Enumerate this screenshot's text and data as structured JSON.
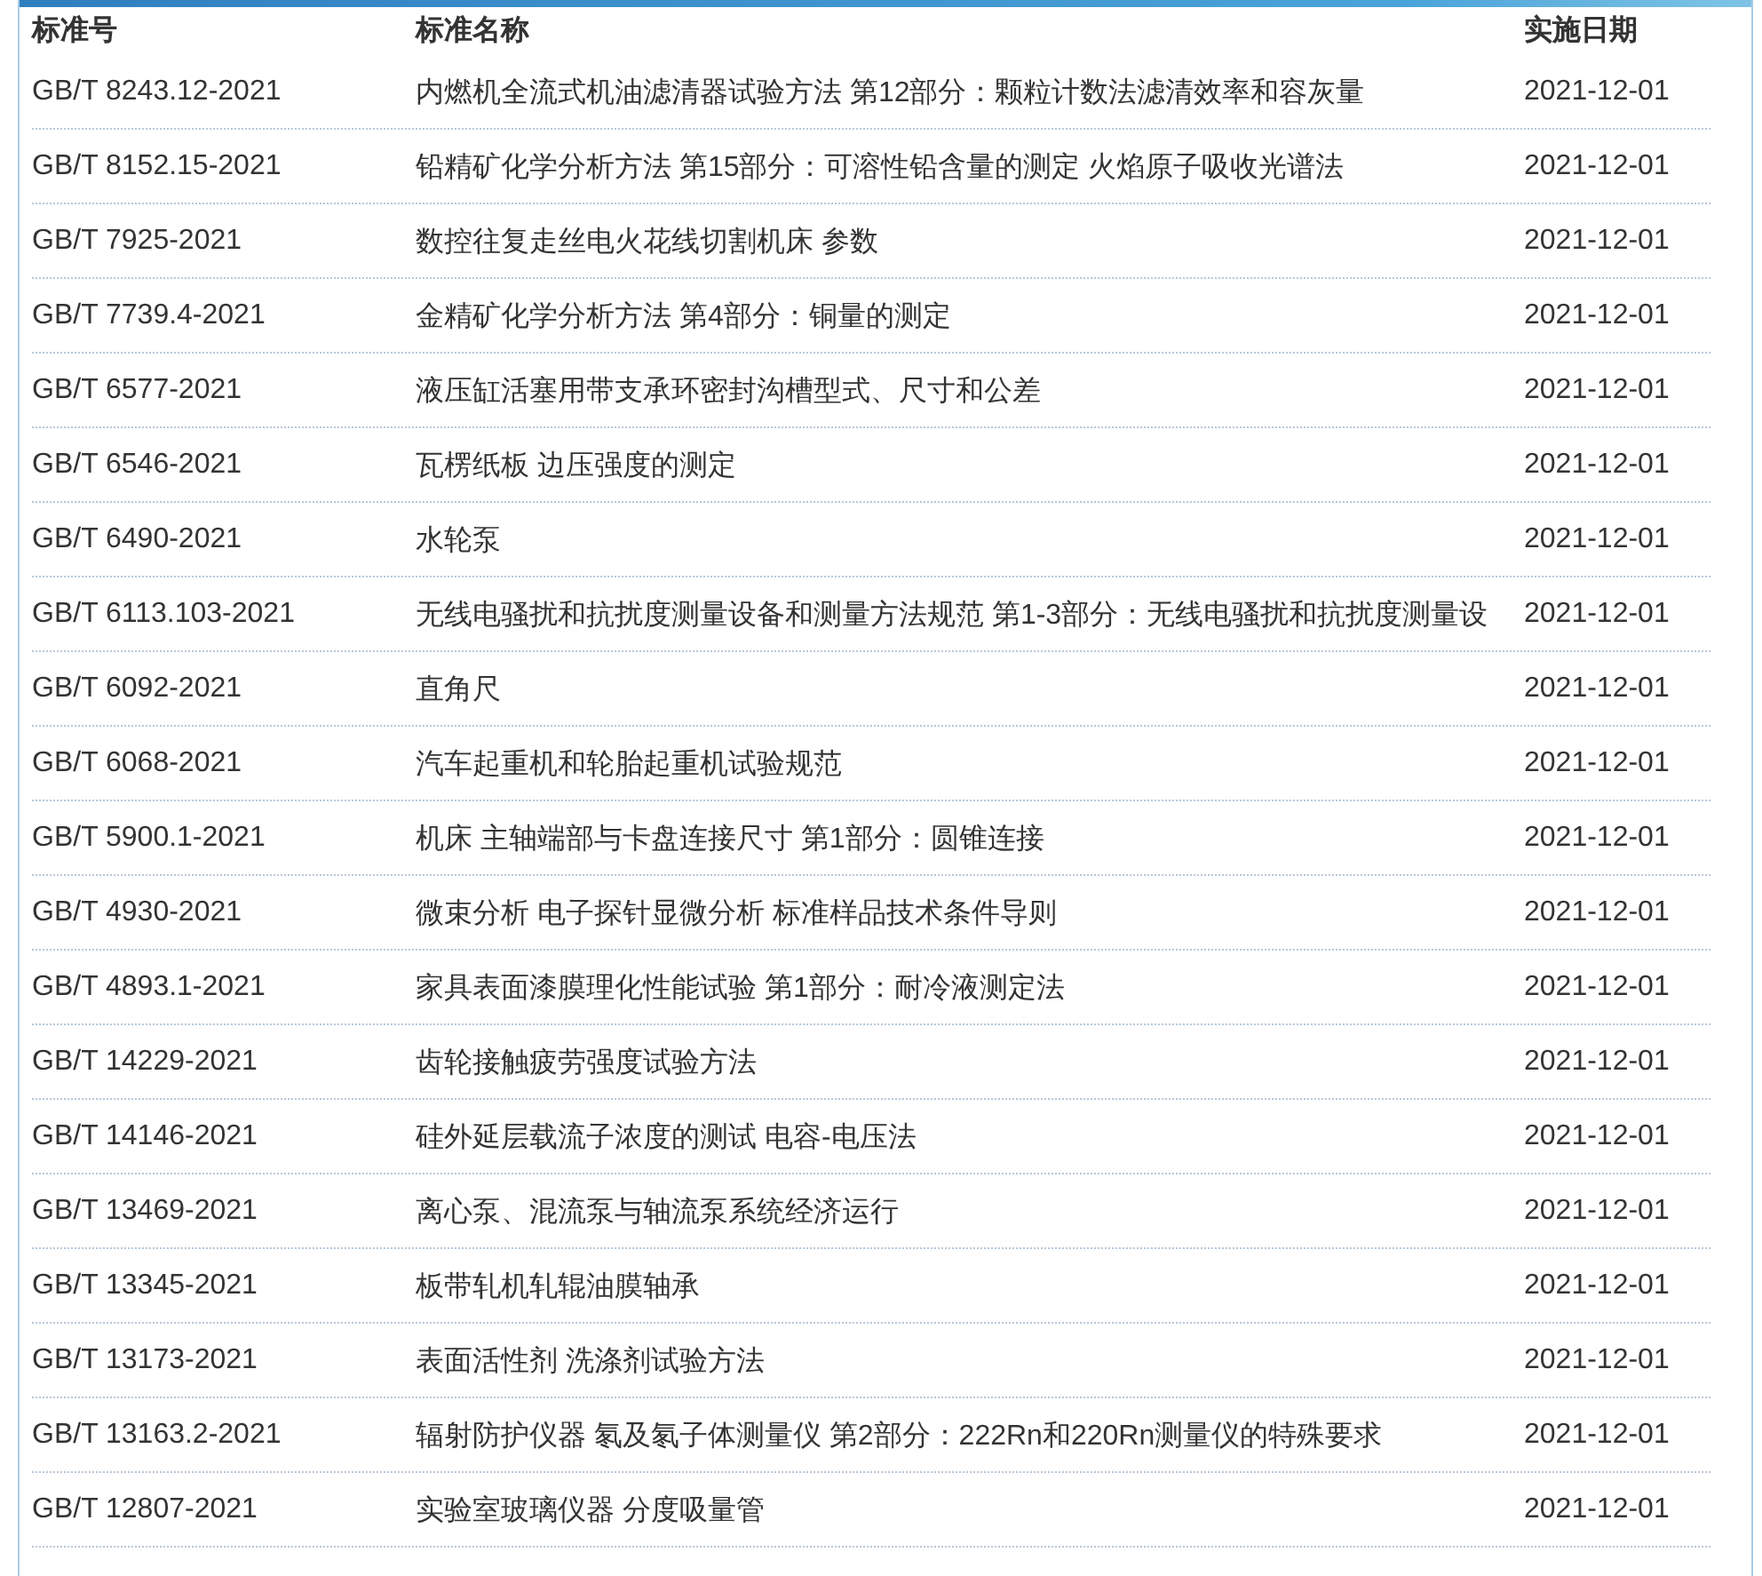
{
  "table": {
    "columns": [
      "标准号",
      "标准名称",
      "实施日期"
    ],
    "rows": [
      {
        "number": "GB/T 8243.12-2021",
        "name": "内燃机全流式机油滤清器试验方法 第12部分：颗粒计数法滤清效率和容灰量",
        "date": "2021-12-01"
      },
      {
        "number": "GB/T 8152.15-2021",
        "name": "铅精矿化学分析方法 第15部分：可溶性铅含量的测定 火焰原子吸收光谱法",
        "date": "2021-12-01"
      },
      {
        "number": "GB/T 7925-2021",
        "name": "数控往复走丝电火花线切割机床 参数",
        "date": "2021-12-01"
      },
      {
        "number": "GB/T 7739.4-2021",
        "name": "金精矿化学分析方法 第4部分：铜量的测定",
        "date": "2021-12-01"
      },
      {
        "number": "GB/T 6577-2021",
        "name": "液压缸活塞用带支承环密封沟槽型式、尺寸和公差",
        "date": "2021-12-01"
      },
      {
        "number": "GB/T 6546-2021",
        "name": "瓦楞纸板 边压强度的测定",
        "date": "2021-12-01"
      },
      {
        "number": "GB/T 6490-2021",
        "name": "水轮泵",
        "date": "2021-12-01"
      },
      {
        "number": "GB/T 6113.103-2021",
        "name": "无线电骚扰和抗扰度测量设备和测量方法规范 第1-3部分：无线电骚扰和抗扰度测量设",
        "date": "2021-12-01"
      },
      {
        "number": "GB/T 6092-2021",
        "name": "直角尺",
        "date": "2021-12-01"
      },
      {
        "number": "GB/T 6068-2021",
        "name": "汽车起重机和轮胎起重机试验规范",
        "date": "2021-12-01"
      },
      {
        "number": "GB/T 5900.1-2021",
        "name": "机床 主轴端部与卡盘连接尺寸 第1部分：圆锥连接",
        "date": "2021-12-01"
      },
      {
        "number": "GB/T 4930-2021",
        "name": "微束分析 电子探针显微分析 标准样品技术条件导则",
        "date": "2021-12-01"
      },
      {
        "number": "GB/T 4893.1-2021",
        "name": "家具表面漆膜理化性能试验 第1部分：耐冷液测定法",
        "date": "2021-12-01"
      },
      {
        "number": "GB/T 14229-2021",
        "name": "齿轮接触疲劳强度试验方法",
        "date": "2021-12-01"
      },
      {
        "number": "GB/T 14146-2021",
        "name": "硅外延层载流子浓度的测试 电容-电压法",
        "date": "2021-12-01"
      },
      {
        "number": "GB/T 13469-2021",
        "name": "离心泵、混流泵与轴流泵系统经济运行",
        "date": "2021-12-01"
      },
      {
        "number": "GB/T 13345-2021",
        "name": "板带轧机轧辊油膜轴承",
        "date": "2021-12-01"
      },
      {
        "number": "GB/T 13173-2021",
        "name": "表面活性剂 洗涤剂试验方法",
        "date": "2021-12-01"
      },
      {
        "number": "GB/T 13163.2-2021",
        "name": "辐射防护仪器 氡及氡子体测量仪 第2部分：222Rn和220Rn测量仪的特殊要求",
        "date": "2021-12-01"
      },
      {
        "number": "GB/T 12807-2021",
        "name": "实验室玻璃仪器 分度吸量管",
        "date": "2021-12-01"
      }
    ]
  }
}
